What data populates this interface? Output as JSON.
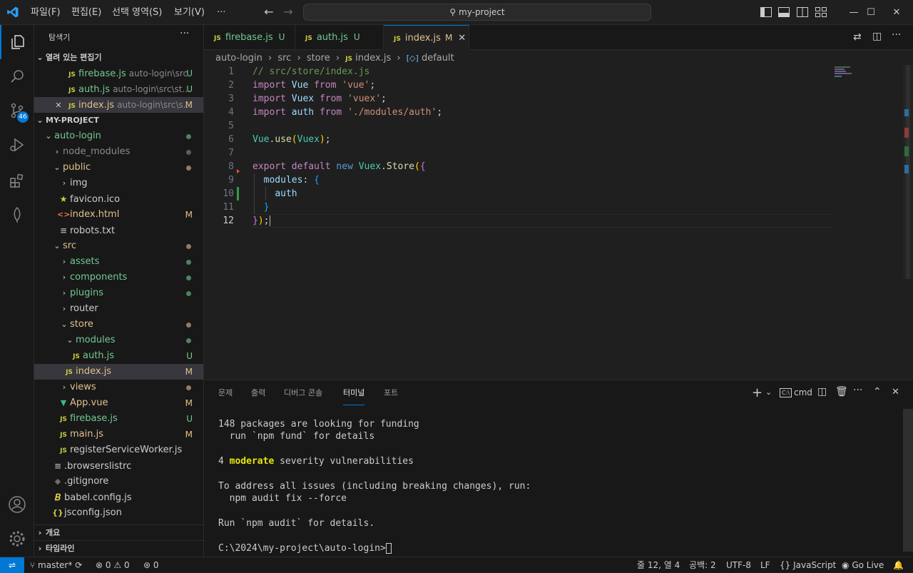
{
  "menu": [
    "파일(F)",
    "편집(E)",
    "선택 영역(S)",
    "보기(V)",
    "···"
  ],
  "search": {
    "text": "my-project"
  },
  "activity": {
    "scm_badge": "46"
  },
  "sidebar": {
    "title": "탐색기",
    "more": "···",
    "open_editors": {
      "title": "열려 있는 편집기",
      "items": [
        {
          "name": "firebase.js",
          "path": "auto-login\\src",
          "status": "U"
        },
        {
          "name": "auth.js",
          "path": "auto-login\\src\\st...",
          "status": "U"
        },
        {
          "name": "index.js",
          "path": "auto-login\\src\\s...",
          "status": "M"
        }
      ]
    },
    "project": {
      "title": "MY-PROJECT",
      "items": [
        {
          "label": "auto-login",
          "status": ""
        },
        {
          "label": "node_modules",
          "status": ""
        },
        {
          "label": "public",
          "status": ""
        },
        {
          "label": "img",
          "status": ""
        },
        {
          "label": "favicon.ico",
          "status": ""
        },
        {
          "label": "index.html",
          "status": "M"
        },
        {
          "label": "robots.txt",
          "status": ""
        },
        {
          "label": "src",
          "status": ""
        },
        {
          "label": "assets",
          "status": ""
        },
        {
          "label": "components",
          "status": ""
        },
        {
          "label": "plugins",
          "status": ""
        },
        {
          "label": "router",
          "status": ""
        },
        {
          "label": "store",
          "status": ""
        },
        {
          "label": "modules",
          "status": ""
        },
        {
          "label": "auth.js",
          "status": "U"
        },
        {
          "label": "index.js",
          "status": "M"
        },
        {
          "label": "views",
          "status": ""
        },
        {
          "label": "App.vue",
          "status": "M"
        },
        {
          "label": "firebase.js",
          "status": "U"
        },
        {
          "label": "main.js",
          "status": "M"
        },
        {
          "label": "registerServiceWorker.js",
          "status": ""
        },
        {
          "label": ".browserslistrc",
          "status": ""
        },
        {
          "label": ".gitignore",
          "status": ""
        },
        {
          "label": "babel.config.js",
          "status": ""
        },
        {
          "label": "jsconfig.json",
          "status": ""
        }
      ]
    },
    "outline": "개요",
    "timeline": "타임라인"
  },
  "tabs": [
    {
      "name": "firebase.js",
      "status": "U"
    },
    {
      "name": "auth.js",
      "status": "U"
    },
    {
      "name": "index.js",
      "status": "M"
    }
  ],
  "breadcrumbs": [
    "auto-login",
    "src",
    "store",
    "index.js",
    "default"
  ],
  "code": {
    "line_numbers": [
      "1",
      "2",
      "3",
      "4",
      "5",
      "6",
      "7",
      "8",
      "9",
      "10",
      "11",
      "12"
    ],
    "lines": [
      "// src/store/index.js",
      "import Vue from 'vue';",
      "import Vuex from 'vuex';",
      "import auth from './modules/auth';",
      "",
      "Vue.use(Vuex);",
      "",
      "export default new Vuex.Store({",
      "  modules: {",
      "    auth",
      "  }",
      "});"
    ],
    "tokens": {
      "import": "import",
      "from": "from",
      "export": "export",
      "default": "default",
      "new": "new",
      "Vue": "Vue",
      "Vuex": "Vuex",
      "auth": "auth",
      "vue_str": "'vue'",
      "vuex_str": "'vuex'",
      "auth_str": "'./modules/auth'",
      "use": "use",
      "Store": "Store",
      "modules": "modules"
    }
  },
  "panel": {
    "tabs": [
      "문제",
      "출력",
      "디버그 콘솔",
      "터미널",
      "포트"
    ],
    "shell": "cmd",
    "terminal_lines": [
      "148 packages are looking for funding",
      "  run `npm fund` for details",
      "",
      "4 moderate severity vulnerabilities",
      "",
      "To address all issues (including breaking changes), run:",
      "  npm audit fix --force",
      "",
      "Run `npm audit` for details.",
      "",
      "C:\\2024\\my-project\\auto-login>"
    ],
    "moderate_word": "moderate"
  },
  "status": {
    "branch": "master*",
    "errors": "0",
    "warnings": "0",
    "ports": "0",
    "position": "줄 12, 열 4",
    "spaces": "공백: 2",
    "encoding": "UTF-8",
    "eol": "LF",
    "language": "JavaScript",
    "golive": "Go Live"
  },
  "colors": {
    "accent": "#0078d4",
    "untracked": "#73c991",
    "modified": "#e2c08d"
  }
}
